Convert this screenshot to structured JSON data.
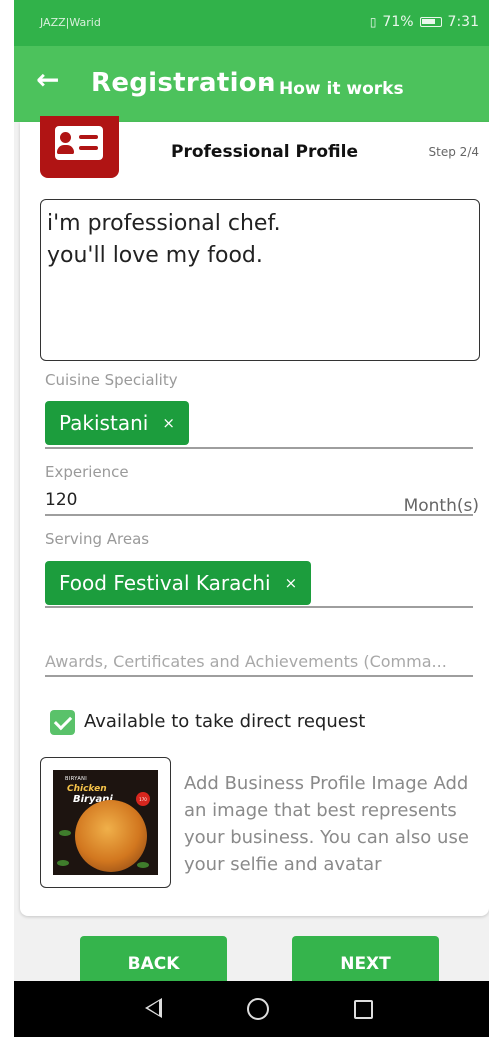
{
  "status_bar": {
    "carrier": "JAZZ|Warid",
    "battery": "71%",
    "time": "7:31"
  },
  "app_bar": {
    "back_icon": "arrow-left-icon",
    "title": "Registration",
    "separator": "-",
    "help_link": "How it works"
  },
  "card": {
    "title": "Professional Profile",
    "step": "Step 2/4",
    "icon": "id-card-icon"
  },
  "bio": {
    "value": "i'm professional chef.\nyou'll love my food."
  },
  "cuisine": {
    "label": "Cuisine Speciality",
    "chips": [
      "Pakistani"
    ]
  },
  "experience": {
    "label": "Experience",
    "value": "120",
    "unit": "Month(s)"
  },
  "serving_areas": {
    "label": "Serving Areas",
    "chips": [
      "Food Festival Karachi"
    ]
  },
  "awards": {
    "placeholder": "Awards, Certificates and Achievements (Comma..."
  },
  "direct_request": {
    "label": "Available to take direct request",
    "checked": true
  },
  "profile_image": {
    "text": "Add Business Profile Image Add an image that best represents your business. You can also use your selfie and avatar",
    "poster": {
      "line1": "Chicken",
      "line2": "Biryani",
      "top": "BIRYANI",
      "price": "170"
    }
  },
  "buttons": {
    "back": "BACK",
    "next": "NEXT"
  },
  "nav": {
    "back_icon": "triangle-back-icon",
    "home_icon": "circle-home-icon",
    "recents_icon": "square-recents-icon"
  },
  "colors": {
    "status_bar": "#31b24a",
    "app_bar": "#4cc25c",
    "chip": "#1c9d3d",
    "badge": "#b01414",
    "button": "#35b44c"
  }
}
